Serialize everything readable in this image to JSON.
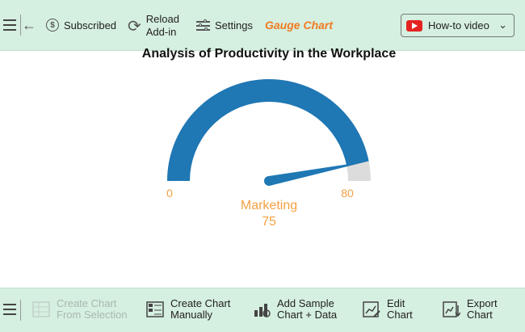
{
  "toolbar": {
    "subscribed_label": "Subscribed",
    "reload_label": "Reload Add-in",
    "settings_label": "Settings",
    "app_title": "Gauge Chart",
    "howto_label": "How-to video"
  },
  "chart_data": {
    "type": "gauge",
    "title": "Analysis of Productivity in the Workplace",
    "min": 0,
    "max": 80,
    "value": 75,
    "label": "Marketing",
    "min_label": "0",
    "max_label": "80",
    "value_label": "75",
    "colors": {
      "fill": "#1f77b4",
      "track": "#dcdcdc",
      "labels": "#f5a042",
      "needle": "#1f77b4"
    }
  },
  "bottom": {
    "create_from_selection": "Create Chart From Selection",
    "create_manually": "Create Chart Manually",
    "add_sample": "Add Sample Chart + Data",
    "edit_chart": "Edit Chart",
    "export_chart": "Export Chart"
  },
  "colors": {
    "bar_bg": "#d5efe0",
    "accent": "#f07b22",
    "youtube": "#e52320"
  }
}
